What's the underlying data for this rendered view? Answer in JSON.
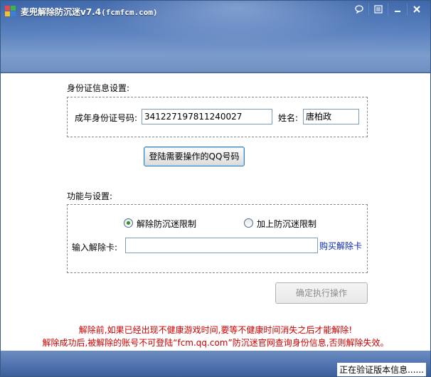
{
  "window": {
    "title": "麦兜解除防沉迷v7.4(fcmfcm.com)",
    "title_main": "麦兜解除防沉迷v7.4",
    "title_url": "(fcmfcm.com)",
    "buttons": {
      "chat": "chat-bubble-icon",
      "menu": "menu-icon",
      "minimize": "minimize-icon",
      "close": "close-icon"
    }
  },
  "id_section": {
    "heading": "身份证信息设置:",
    "id_label": "成年身份证号码:",
    "id_value": "341227197811240027",
    "name_label": "姓名:",
    "name_value": "唐柏政"
  },
  "login_button": "登陆需要操作的QQ号码",
  "func_section": {
    "heading": "功能与设置:",
    "radio_remove": "解除防沉迷限制",
    "radio_add": "加上防沉迷限制",
    "selected": "remove",
    "card_label": "输入解除卡:",
    "card_value": "",
    "buy_link": "购买解除卡"
  },
  "confirm_button": "确定执行操作",
  "warnings": {
    "line1": "解除前,如果已经出现不健康游戏时间,要等不健康时间消失之后才能解除!",
    "line2": "解除成功后,被解除的账号不可登陆“fcm.qq.com”防沉迷官网查询身份信息,否则解除失效。"
  },
  "status_text": "正在验证版本信息......",
  "colors": {
    "warning": "#cc0000",
    "link": "#0a2aa8",
    "banner": "#3a64a8"
  }
}
